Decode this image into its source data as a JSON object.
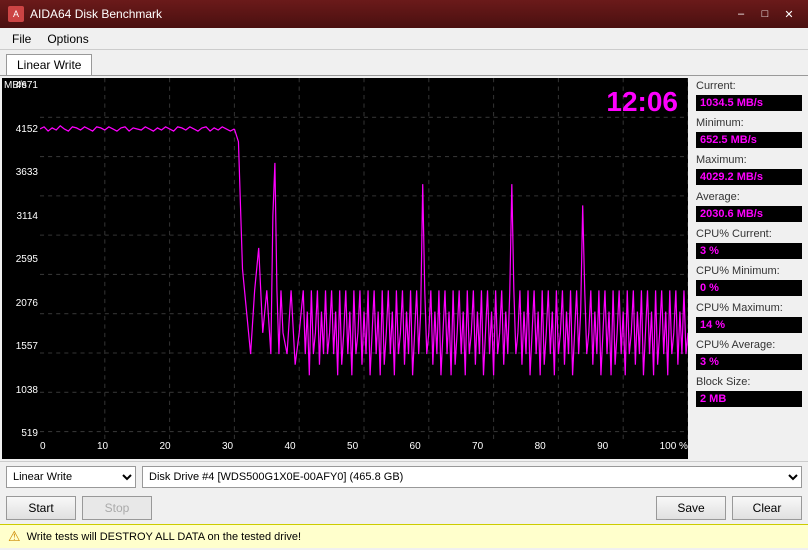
{
  "titleBar": {
    "title": "AIDA64 Disk Benchmark",
    "icon": "A"
  },
  "menuBar": {
    "items": [
      "File",
      "Options"
    ]
  },
  "tabs": [
    {
      "label": "Linear Write",
      "active": true
    }
  ],
  "chart": {
    "timeDisplay": "12:06",
    "yAxisTitle": "MB/s",
    "yLabels": [
      "4671",
      "4152",
      "3633",
      "3114",
      "2595",
      "2076",
      "1557",
      "1038",
      "519",
      ""
    ],
    "xLabels": [
      "0",
      "10",
      "20",
      "30",
      "40",
      "50",
      "60",
      "70",
      "80",
      "90",
      "100 %"
    ]
  },
  "stats": {
    "currentLabel": "Current:",
    "currentValue": "1034.5 MB/s",
    "minimumLabel": "Minimum:",
    "minimumValue": "652.5 MB/s",
    "maximumLabel": "Maximum:",
    "maximumValue": "4029.2 MB/s",
    "averageLabel": "Average:",
    "averageValue": "2030.6 MB/s",
    "cpuCurrentLabel": "CPU% Current:",
    "cpuCurrentValue": "3 %",
    "cpuMinLabel": "CPU% Minimum:",
    "cpuMinValue": "0 %",
    "cpuMaxLabel": "CPU% Maximum:",
    "cpuMaxValue": "14 %",
    "cpuAvgLabel": "CPU% Average:",
    "cpuAvgValue": "3 %",
    "blockSizeLabel": "Block Size:",
    "blockSizeValue": "2 MB"
  },
  "controls": {
    "testDropdown": "Linear Write",
    "driveDropdown": "Disk Drive #4  [WDS500G1X0E-00AFY0]  (465.8 GB)",
    "startBtn": "Start",
    "stopBtn": "Stop",
    "saveBtn": "Save",
    "clearBtn": "Clear"
  },
  "warning": {
    "text": "Write tests will DESTROY ALL DATA on the tested drive!"
  }
}
